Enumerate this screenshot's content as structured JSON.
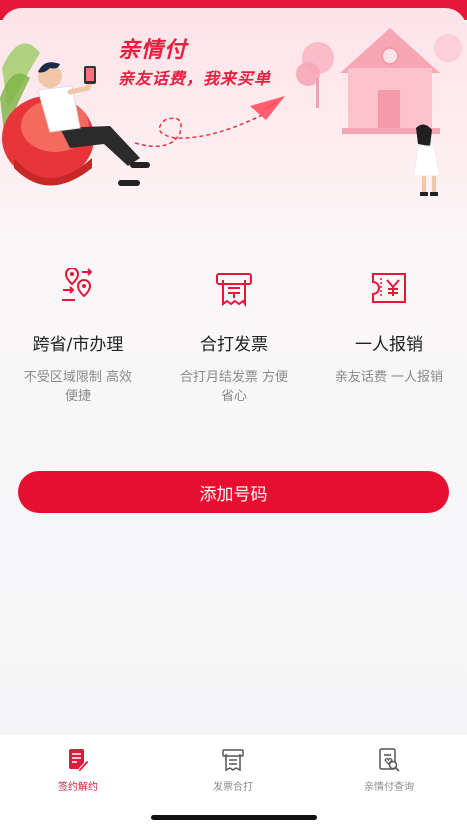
{
  "banner": {
    "title": "亲情付",
    "subtitle": "亲友话费，我来买单"
  },
  "features": [
    {
      "icon": "location-transfer-icon",
      "title": "跨省/市办理",
      "desc": "不受区域限制 高效便捷"
    },
    {
      "icon": "receipt-print-icon",
      "title": "合打发票",
      "desc": "合打月结发票 方便省心"
    },
    {
      "icon": "yuan-ticket-icon",
      "title": "一人报销",
      "desc": "亲友话费 一人报销"
    }
  ],
  "add_button": {
    "label": "添加号码"
  },
  "tabbar": {
    "items": [
      {
        "label": "签约解约",
        "icon": "contract-sign-icon",
        "active": true
      },
      {
        "label": "发票合打",
        "icon": "invoice-print-icon",
        "active": false
      },
      {
        "label": "亲情付查询",
        "icon": "query-search-icon",
        "active": false
      }
    ]
  },
  "colors": {
    "accent": "#e60f30",
    "active_tab": "#d81e3a",
    "inactive_tab": "#8c8c8c"
  }
}
